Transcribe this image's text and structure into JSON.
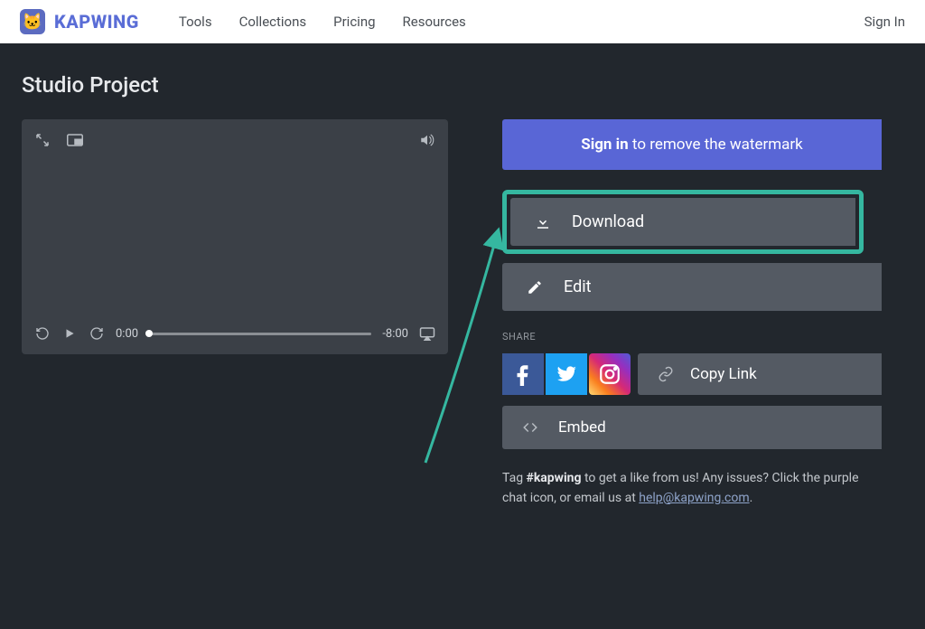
{
  "brand": {
    "name": "KAPWING"
  },
  "nav": {
    "tools": "Tools",
    "collections": "Collections",
    "pricing": "Pricing",
    "resources": "Resources"
  },
  "topbar": {
    "sign_in": "Sign In"
  },
  "page": {
    "title": "Studio Project"
  },
  "player": {
    "current_time": "0:00",
    "remaining_time": "-8:00"
  },
  "banner": {
    "bold": "Sign in",
    "rest": " to remove the watermark"
  },
  "actions": {
    "download": "Download",
    "edit": "Edit"
  },
  "share": {
    "label": "SHARE",
    "copy_link": "Copy Link",
    "embed": "Embed"
  },
  "footer": {
    "prefix": "Tag ",
    "hashtag": "#kapwing",
    "mid": " to get a like from us! Any issues? Click the purple chat icon, or email us at ",
    "email": "help@kapwing.com",
    "suffix": "."
  }
}
